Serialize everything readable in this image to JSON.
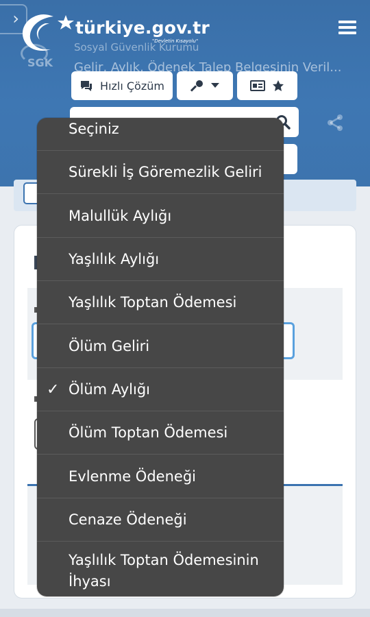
{
  "header": {
    "logo_text": "türkiye.gov.tr",
    "logo_sub": "\"Devletin Kısayolu\"",
    "sgk_abbr": "SGK",
    "institution": "Sosyal Güvenlik Kurumu",
    "page_title": "Gelir, Aylık, Ödenek Talep Belgesinin Veril...",
    "quick_solution_label": "Hızlı Çözüm"
  },
  "dropdown": {
    "selected": "Ölüm Aylığı",
    "options": [
      {
        "label": "Seçiniz",
        "checked": false
      },
      {
        "label": "Sürekli İş Göremezlik Geliri",
        "checked": false
      },
      {
        "label": "Malullük Aylığı",
        "checked": false
      },
      {
        "label": "Yaşlılık Aylığı",
        "checked": false
      },
      {
        "label": "Yaşlılık Toptan Ödemesi",
        "checked": false
      },
      {
        "label": "Ölüm Geliri",
        "checked": false
      },
      {
        "label": "Ölüm Aylığı",
        "checked": true
      },
      {
        "label": "Ölüm Toptan Ödemesi",
        "checked": false
      },
      {
        "label": "Evlenme Ödeneği",
        "checked": false
      },
      {
        "label": "Cenaze Ödeneği",
        "checked": false
      },
      {
        "label": "Yaşlılık Toptan Ödemesinin İhyası",
        "checked": false
      }
    ],
    "check_glyph": "✓"
  },
  "icons": {
    "sidebar": "chevron-right-icon",
    "menu": "hamburger-icon",
    "chat": "chat-icon",
    "key": "key-icon",
    "caret": "caret-down-icon",
    "id_card": "id-card-icon",
    "star": "star-icon",
    "search": "search-icon",
    "share": "share-icon"
  },
  "colors": {
    "header_blue": "#3e77b3",
    "dropdown_bg": "#474747",
    "focus_outline": "#5aa1de"
  }
}
